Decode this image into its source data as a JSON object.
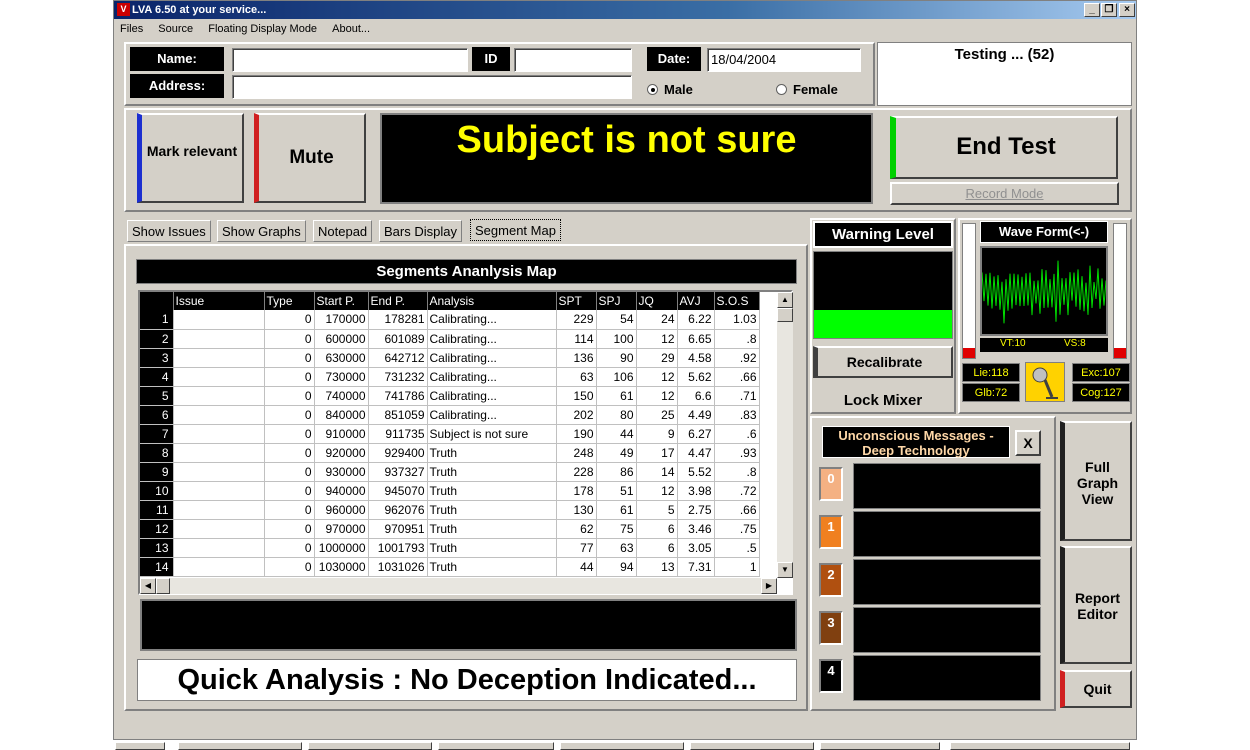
{
  "window": {
    "title": "LVA 6.50 at your service...",
    "icon": "lva-app-icon"
  },
  "menu": [
    "Files",
    "Source",
    "Floating Display Mode",
    "About..."
  ],
  "form": {
    "name_label": "Name:",
    "id_label": "ID",
    "address_label": "Address:",
    "date_label": "Date:",
    "date_value": "18/04/2004",
    "name_value": "",
    "id_value": "",
    "address_value": "",
    "gender_male": "Male",
    "gender_female": "Female",
    "gender_selected": "Male"
  },
  "testing_status": "Testing ... (52)",
  "buttons": {
    "mark_relevant": "Mark relevant",
    "mute": "Mute",
    "end_test": "End Test",
    "record_mode": "Record Mode",
    "recalibrate": "Recalibrate",
    "lock_mixer": "Lock Mixer",
    "full_graph_view": "Full Graph View",
    "report_editor": "Report Editor",
    "quit": "Quit",
    "close_x": "X"
  },
  "main_message": "Subject is not sure",
  "tabs": [
    "Show Issues",
    "Show Graphs",
    "Notepad",
    "Bars Display",
    "Segment Map"
  ],
  "active_tab": "Segment Map",
  "segments": {
    "title": "Segments Ananlysis Map",
    "columns": [
      "Issue",
      "Type",
      "Start P.",
      "End P.",
      "Analysis",
      "SPT",
      "SPJ",
      "JQ",
      "AVJ",
      "S.O.S"
    ],
    "rows": [
      [
        "1",
        "",
        "0",
        "170000",
        "178281",
        "Calibrating...",
        "229",
        "54",
        "24",
        "6.22",
        "1.03"
      ],
      [
        "2",
        "",
        "0",
        "600000",
        "601089",
        "Calibrating...",
        "114",
        "100",
        "12",
        "6.65",
        ".8"
      ],
      [
        "3",
        "",
        "0",
        "630000",
        "642712",
        "Calibrating...",
        "136",
        "90",
        "29",
        "4.58",
        ".92"
      ],
      [
        "4",
        "",
        "0",
        "730000",
        "731232",
        "Calibrating...",
        "63",
        "106",
        "12",
        "5.62",
        ".66"
      ],
      [
        "5",
        "",
        "0",
        "740000",
        "741786",
        "Calibrating...",
        "150",
        "61",
        "12",
        "6.6",
        ".71"
      ],
      [
        "6",
        "",
        "0",
        "840000",
        "851059",
        "Calibrating...",
        "202",
        "80",
        "25",
        "4.49",
        ".83"
      ],
      [
        "7",
        "",
        "0",
        "910000",
        "911735",
        "Subject is not sure",
        "190",
        "44",
        "9",
        "6.27",
        ".6"
      ],
      [
        "8",
        "",
        "0",
        "920000",
        "929400",
        "Truth",
        "248",
        "49",
        "17",
        "4.47",
        ".93"
      ],
      [
        "9",
        "",
        "0",
        "930000",
        "937327",
        "Truth",
        "228",
        "86",
        "14",
        "5.52",
        ".8"
      ],
      [
        "10",
        "",
        "0",
        "940000",
        "945070",
        "Truth",
        "178",
        "51",
        "12",
        "3.98",
        ".72"
      ],
      [
        "11",
        "",
        "0",
        "960000",
        "962076",
        "Truth",
        "130",
        "61",
        "5",
        "2.75",
        ".66"
      ],
      [
        "12",
        "",
        "0",
        "970000",
        "970951",
        "Truth",
        "62",
        "75",
        "6",
        "3.46",
        ".75"
      ],
      [
        "13",
        "",
        "0",
        "1000000",
        "1001793",
        "Truth",
        "77",
        "63",
        "6",
        "3.05",
        ".5"
      ],
      [
        "14",
        "",
        "0",
        "1030000",
        "1031026",
        "Truth",
        "44",
        "94",
        "13",
        "7.31",
        "1"
      ]
    ]
  },
  "quick_analysis": "Quick Analysis : No Deception Indicated...",
  "warning": {
    "label": "Warning Level",
    "level": 0.33,
    "color": "#00ff00"
  },
  "waveform": {
    "title": "Wave Form(<-)",
    "vt": "VT:10",
    "vs": "VS:8"
  },
  "indicators": {
    "lie": "Lie:118",
    "exc": "Exc:107",
    "glb": "Glb:72",
    "cog": "Cog:127"
  },
  "unconscious": {
    "title": "Unconscious Messages - Deep Technology",
    "levels": [
      {
        "label": "0",
        "color": "#f4b183"
      },
      {
        "label": "1",
        "color": "#f08020"
      },
      {
        "label": "2",
        "color": "#b05010"
      },
      {
        "label": "3",
        "color": "#804010"
      },
      {
        "label": "4",
        "color": "#000000"
      }
    ]
  },
  "icons": {
    "microphone": "microphone-icon",
    "minimize": "minimize-icon",
    "restore": "restore-icon",
    "close": "close-icon"
  }
}
